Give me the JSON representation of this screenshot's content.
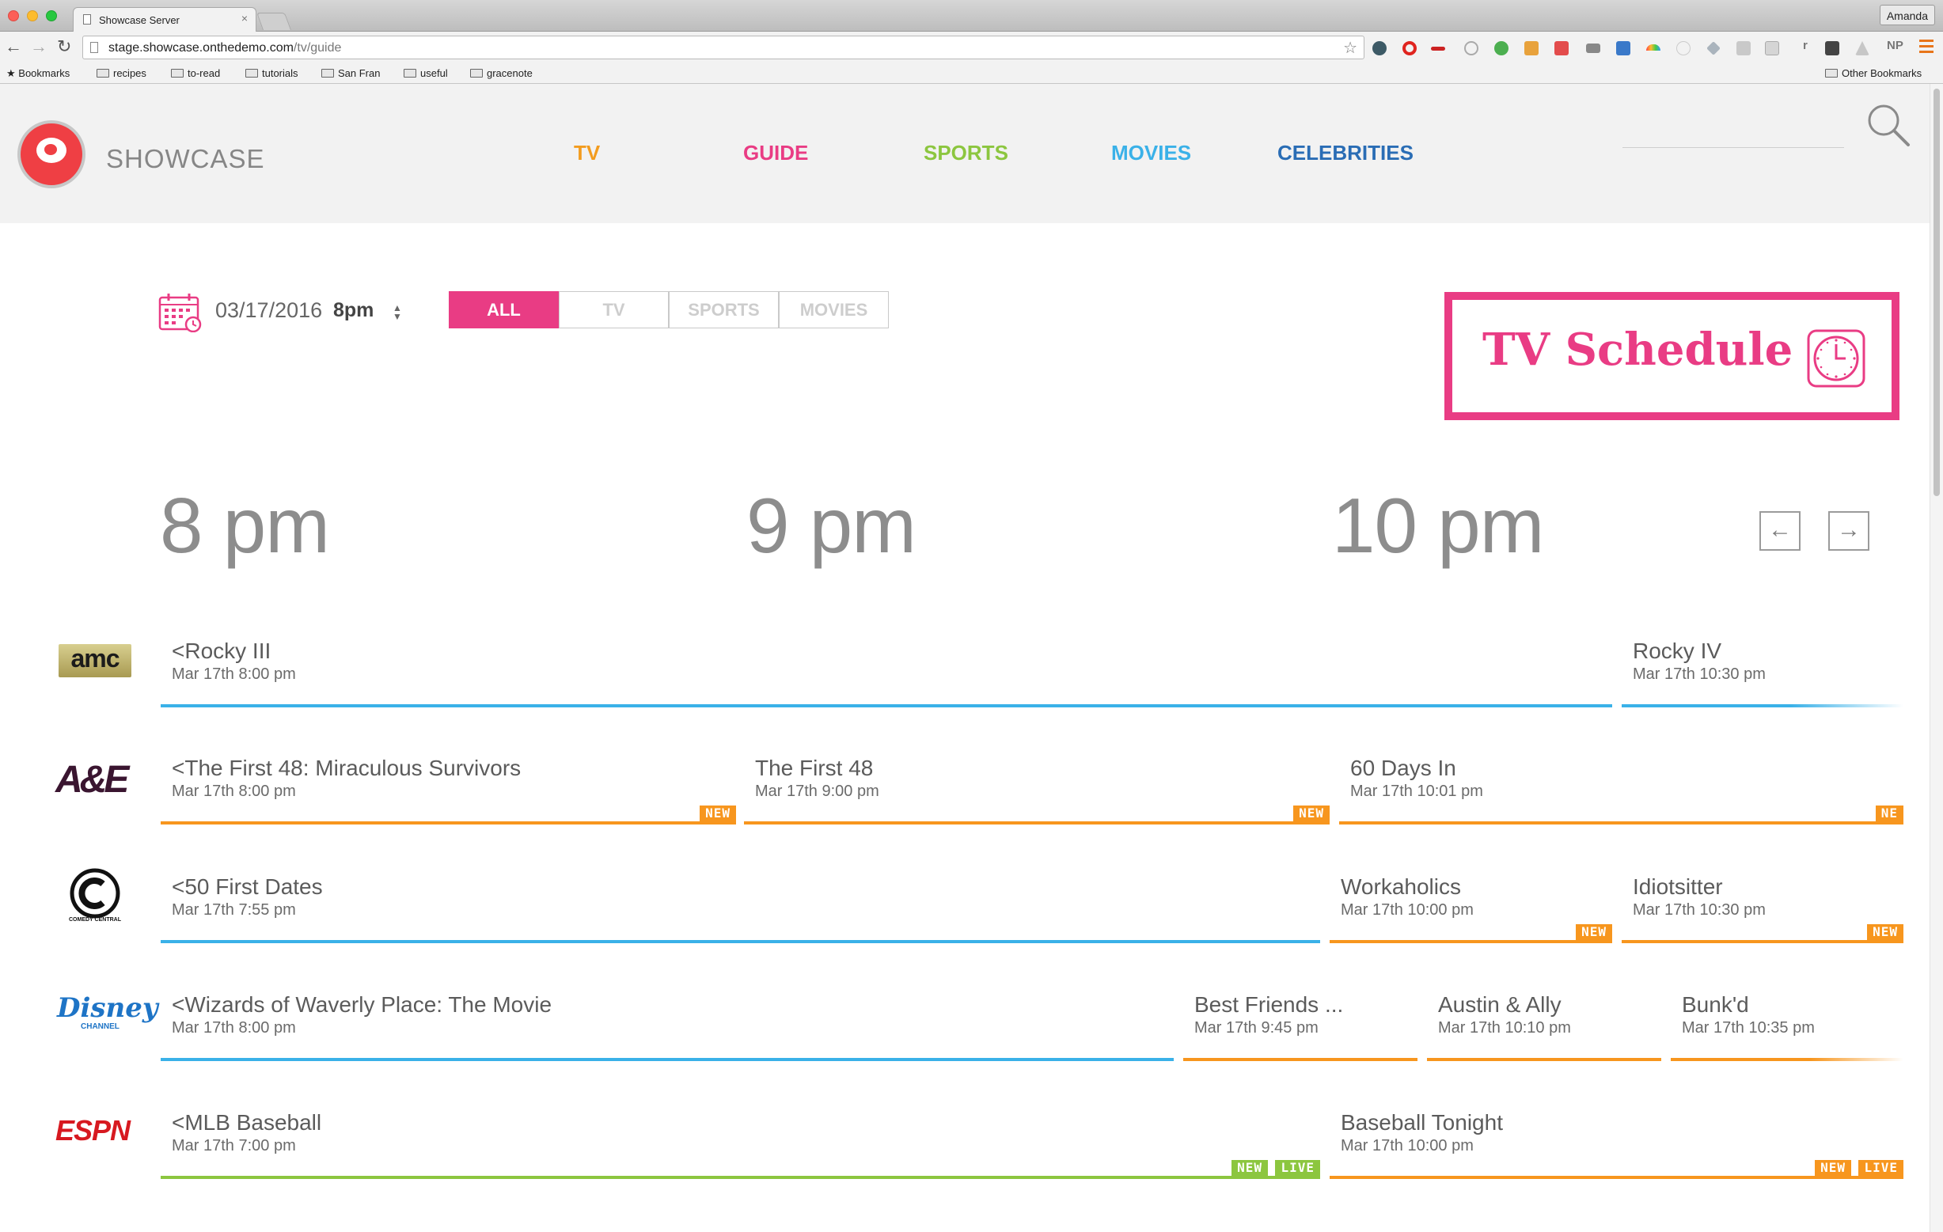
{
  "browser": {
    "tab_title": "Showcase Server",
    "tab_close": "×",
    "url_host": "stage.showcase.onthedemo.com",
    "url_path": "/tv/guide",
    "profile": "Amanda",
    "bookmarks": [
      "Bookmarks",
      "recipes",
      "to-read",
      "tutorials",
      "San Fran",
      "useful",
      "gracenote"
    ],
    "other_bookmarks": "Other Bookmarks",
    "ext_r": "r",
    "ext_np": "NP"
  },
  "site": {
    "brand": "SHOWCASE",
    "nav": [
      {
        "label": "TV",
        "color": "#f39c1f"
      },
      {
        "label": "GUIDE",
        "color": "#e93c84"
      },
      {
        "label": "SPORTS",
        "color": "#8cc63f"
      },
      {
        "label": "MOVIES",
        "color": "#3ab1e8"
      },
      {
        "label": "CELEBRITIES",
        "color": "#2a6db5"
      }
    ]
  },
  "guide": {
    "date": "03/17/2016",
    "time": "8pm",
    "filters": [
      {
        "label": "ALL",
        "active": true
      },
      {
        "label": "TV",
        "active": false
      },
      {
        "label": "SPORTS",
        "active": false
      },
      {
        "label": "MOVIES",
        "active": false
      }
    ],
    "schedule_title": "TV Schedule",
    "hours": [
      "8 pm",
      "9 pm",
      "10 pm"
    ],
    "prev_arrow": "←",
    "next_arrow": "→",
    "colors": {
      "movie": "#3ab1e8",
      "series": "#f7961e",
      "sports": "#8cc63f",
      "accent": "#e93c84"
    },
    "channels": [
      {
        "name": "AMC",
        "logo_text": "amc",
        "programs": [
          {
            "title": "<Rocky III",
            "time": "Mar 17th 8:00 pm",
            "kind": "movie",
            "badges": []
          },
          {
            "title": "Rocky IV",
            "time": "Mar 17th 10:30 pm",
            "kind": "movie",
            "badges": []
          }
        ]
      },
      {
        "name": "A&E",
        "logo_text": "A&E",
        "programs": [
          {
            "title": "<The First 48: Miraculous Survivors",
            "time": "Mar 17th 8:00 pm",
            "kind": "series",
            "badges": [
              "NEW"
            ]
          },
          {
            "title": "The First 48",
            "time": "Mar 17th 9:00 pm",
            "kind": "series",
            "badges": [
              "NEW"
            ]
          },
          {
            "title": "60 Days In",
            "time": "Mar 17th 10:01 pm",
            "kind": "series",
            "badges": [
              "NE"
            ]
          }
        ]
      },
      {
        "name": "Comedy Central",
        "logo_text": "COMEDY CENTRAL",
        "programs": [
          {
            "title": "<50 First Dates",
            "time": "Mar 17th 7:55 pm",
            "kind": "movie",
            "badges": []
          },
          {
            "title": "Workaholics",
            "time": "Mar 17th 10:00 pm",
            "kind": "series",
            "badges": [
              "NEW"
            ]
          },
          {
            "title": "Idiotsitter",
            "time": "Mar 17th 10:30 pm",
            "kind": "series",
            "badges": [
              "NEW"
            ]
          }
        ]
      },
      {
        "name": "Disney Channel",
        "logo_text": "Disney",
        "logo_sub": "CHANNEL",
        "programs": [
          {
            "title": "<Wizards of Waverly Place: The Movie",
            "time": "Mar 17th 8:00 pm",
            "kind": "movie",
            "badges": []
          },
          {
            "title": "Best Friends ...",
            "time": "Mar 17th 9:45 pm",
            "kind": "series",
            "badges": []
          },
          {
            "title": "Austin & Ally",
            "time": "Mar 17th 10:10 pm",
            "kind": "series",
            "badges": []
          },
          {
            "title": "Bunk'd",
            "time": "Mar 17th 10:35 pm",
            "kind": "series",
            "badges": []
          }
        ]
      },
      {
        "name": "ESPN",
        "logo_text": "ESPN",
        "programs": [
          {
            "title": "<MLB Baseball",
            "time": "Mar 17th 7:00 pm",
            "kind": "sports",
            "badges": [
              "NEW",
              "LIVE"
            ]
          },
          {
            "title": "Baseball Tonight",
            "time": "Mar 17th 10:00 pm",
            "kind": "series",
            "badges": [
              "NEW",
              "LIVE"
            ]
          }
        ]
      }
    ]
  }
}
